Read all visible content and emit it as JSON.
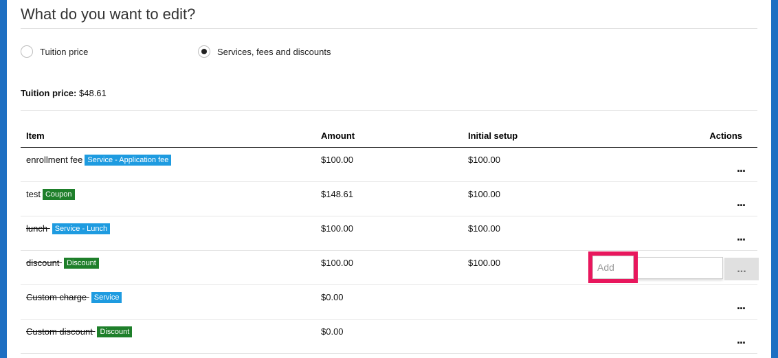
{
  "page": {
    "heading": "What do you want to edit?"
  },
  "edit_options": {
    "tuition_label": "Tuition price",
    "services_label": "Services, fees and discounts",
    "selected": "services"
  },
  "tuition": {
    "label": "Tuition price:",
    "value": "$48.61"
  },
  "table": {
    "headers": {
      "item": "Item",
      "amount": "Amount",
      "initial_setup": "Initial setup",
      "actions": "Actions"
    },
    "rows": [
      {
        "name": "enrollment fee",
        "badge": "Service - Application fee",
        "badge_type": "service",
        "amount": "$100.00",
        "initial_setup": "$100.00",
        "struck": false
      },
      {
        "name": "test",
        "badge": "Coupon",
        "badge_type": "discount",
        "amount": "$148.61",
        "initial_setup": "$100.00",
        "struck": false
      },
      {
        "name": "lunch",
        "badge": "Service - Lunch",
        "badge_type": "service",
        "amount": "$100.00",
        "initial_setup": "$100.00",
        "struck": true
      },
      {
        "name": "discount",
        "badge": "Discount",
        "badge_type": "discount",
        "amount": "$100.00",
        "initial_setup": "$100.00",
        "struck": true
      },
      {
        "name": "Custom charge",
        "badge": "Service",
        "badge_type": "service",
        "amount": "$0.00",
        "initial_setup": "",
        "struck": true
      },
      {
        "name": "Custom discount",
        "badge": "Discount",
        "badge_type": "discount",
        "amount": "$0.00",
        "initial_setup": "",
        "struck": true
      }
    ],
    "actions_label": "..."
  },
  "popup": {
    "add_placeholder": "Add",
    "button_label": "..."
  },
  "colors": {
    "frame": "#1e6fc2",
    "service_badge": "#1e9be0",
    "discount_badge": "#1e7f2a",
    "highlight": "#e8175d"
  }
}
